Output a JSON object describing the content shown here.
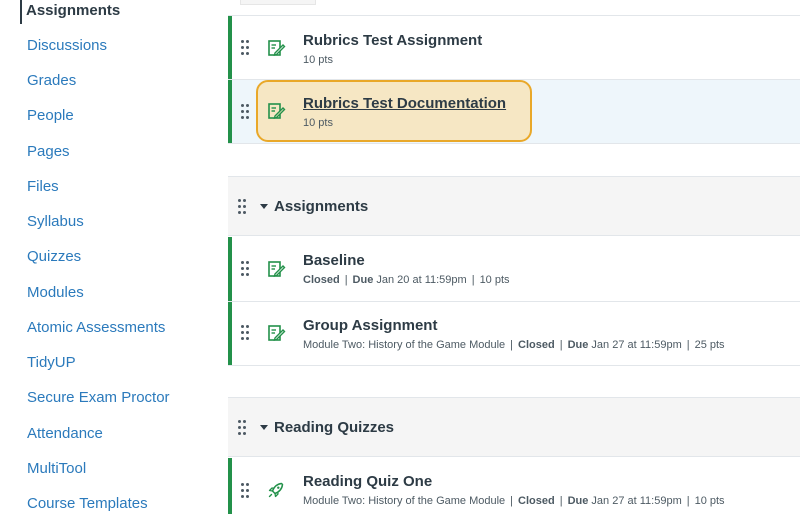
{
  "sidebar": {
    "items": [
      {
        "label": "Assignments",
        "active": true
      },
      {
        "label": "Discussions"
      },
      {
        "label": "Grades"
      },
      {
        "label": "People"
      },
      {
        "label": "Pages"
      },
      {
        "label": "Files"
      },
      {
        "label": "Syllabus"
      },
      {
        "label": "Quizzes"
      },
      {
        "label": "Modules"
      },
      {
        "label": "Atomic Assessments"
      },
      {
        "label": "TidyUP"
      },
      {
        "label": "Secure Exam Proctor"
      },
      {
        "label": "Attendance"
      },
      {
        "label": "MultiTool"
      },
      {
        "label": "Course Templates"
      }
    ]
  },
  "colors": {
    "link": "#2b7abc",
    "published": "#23914a",
    "highlight_fill": "#f6e7c4",
    "highlight_border": "#e9a829"
  },
  "top_items": [
    {
      "title": "Rubrics Test Assignment",
      "points": "10 pts",
      "icon": "assignment-icon"
    },
    {
      "title": "Rubrics Test Documentation",
      "points": "10 pts",
      "icon": "assignment-icon",
      "highlighted": true
    }
  ],
  "groups": [
    {
      "title": "Assignments",
      "items": [
        {
          "title": "Baseline",
          "status": "Closed",
          "due_label": "Due",
          "due": "Jan 20 at 11:59pm",
          "points": "10 pts",
          "icon": "assignment-icon"
        },
        {
          "title": "Group Assignment",
          "module": "Module Two: History of the Game Module",
          "status": "Closed",
          "due_label": "Due",
          "due": "Jan 27 at 11:59pm",
          "points": "25 pts",
          "icon": "assignment-icon"
        }
      ]
    },
    {
      "title": "Reading Quizzes",
      "items": [
        {
          "title": "Reading Quiz One",
          "module": "Module Two: History of the Game Module",
          "status": "Closed",
          "due_label": "Due",
          "due": "Jan 27 at 11:59pm",
          "points": "10 pts",
          "icon": "quiz-rocket-icon"
        }
      ]
    }
  ]
}
